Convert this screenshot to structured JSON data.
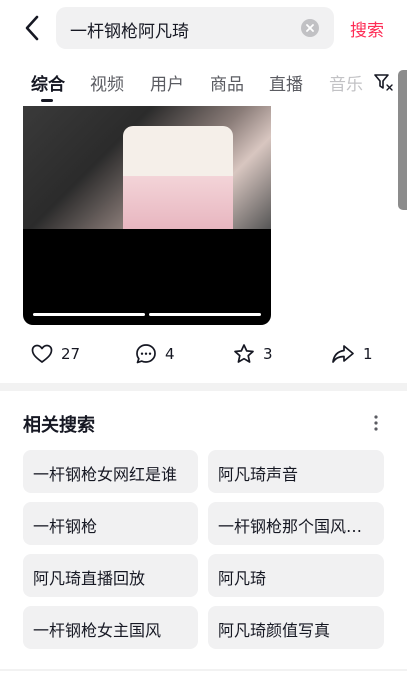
{
  "search": {
    "query": "一杆钢枪阿凡琦",
    "button_label": "搜索"
  },
  "tabs": [
    {
      "label": "综合",
      "active": true
    },
    {
      "label": "视频"
    },
    {
      "label": "用户"
    },
    {
      "label": "商品"
    },
    {
      "label": "直播"
    },
    {
      "label": "音乐"
    }
  ],
  "video": {
    "progress_segments": 2
  },
  "actions": {
    "likes": "27",
    "comments": "4",
    "favorites": "3",
    "shares": "1"
  },
  "related": {
    "title": "相关搜索",
    "items": [
      "一杆钢枪女网红是谁",
      "阿凡琦声音",
      "一杆钢枪",
      "一杆钢枪那个国风…",
      "阿凡琦直播回放",
      "阿凡琦",
      "一杆钢枪女主国风",
      "阿凡琦颜值写真"
    ]
  },
  "colors": {
    "accent": "#fe2c55",
    "text": "#161823",
    "chip_bg": "#f1f1f2"
  }
}
